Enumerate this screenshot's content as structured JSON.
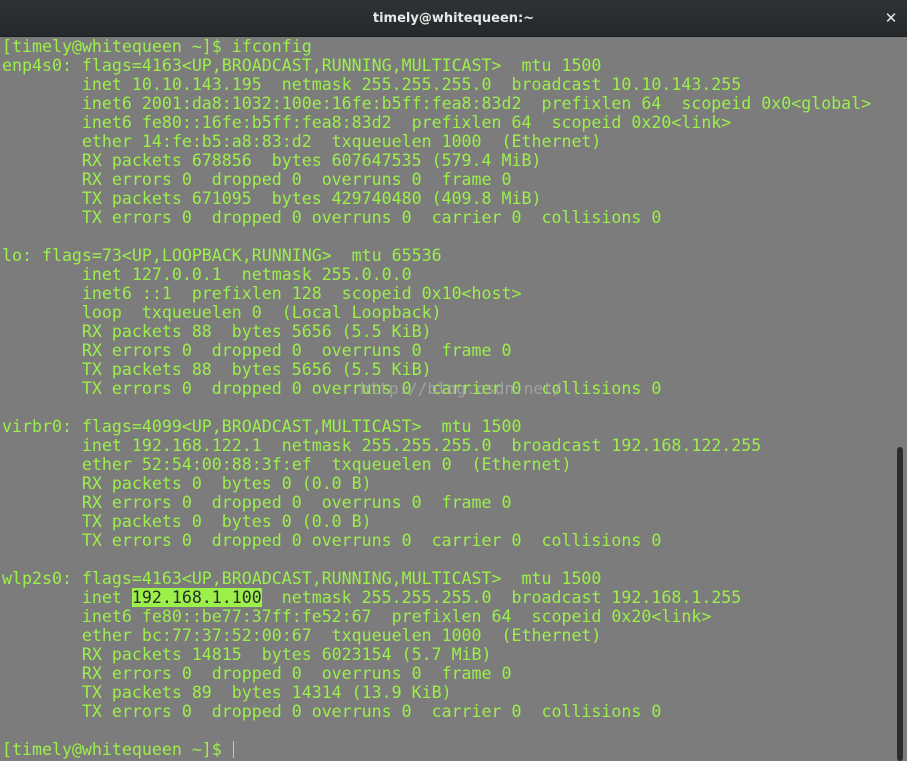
{
  "window": {
    "title": "timely@whitequeen:~",
    "close_glyph": "✕"
  },
  "terminal": {
    "lines": [
      "[timely@whitequeen ~]$ ifconfig",
      "enp4s0: flags=4163<UP,BROADCAST,RUNNING,MULTICAST>  mtu 1500",
      "        inet 10.10.143.195  netmask 255.255.255.0  broadcast 10.10.143.255",
      "        inet6 2001:da8:1032:100e:16fe:b5ff:fea8:83d2  prefixlen 64  scopeid 0x0<global>",
      "        inet6 fe80::16fe:b5ff:fea8:83d2  prefixlen 64  scopeid 0x20<link>",
      "        ether 14:fe:b5:a8:83:d2  txqueuelen 1000  (Ethernet)",
      "        RX packets 678856  bytes 607647535 (579.4 MiB)",
      "        RX errors 0  dropped 0  overruns 0  frame 0",
      "        TX packets 671095  bytes 429740480 (409.8 MiB)",
      "        TX errors 0  dropped 0 overruns 0  carrier 0  collisions 0",
      "",
      "lo: flags=73<UP,LOOPBACK,RUNNING>  mtu 65536",
      "        inet 127.0.0.1  netmask 255.0.0.0",
      "        inet6 ::1  prefixlen 128  scopeid 0x10<host>",
      "        loop  txqueuelen 0  (Local Loopback)",
      "        RX packets 88  bytes 5656 (5.5 KiB)",
      "        RX errors 0  dropped 0  overruns 0  frame 0",
      "        TX packets 88  bytes 5656 (5.5 KiB)",
      "        TX errors 0  dropped 0 overruns 0  carrier 0  collisions 0",
      "",
      "virbr0: flags=4099<UP,BROADCAST,MULTICAST>  mtu 1500",
      "        inet 192.168.122.1  netmask 255.255.255.0  broadcast 192.168.122.255",
      "        ether 52:54:00:88:3f:ef  txqueuelen 0  (Ethernet)",
      "        RX packets 0  bytes 0 (0.0 B)",
      "        RX errors 0  dropped 0  overruns 0  frame 0",
      "        TX packets 0  bytes 0 (0.0 B)",
      "        TX errors 0  dropped 0 overruns 0  carrier 0  collisions 0",
      "",
      "wlp2s0: flags=4163<UP,BROADCAST,RUNNING,MULTICAST>  mtu 1500",
      null,
      "        inet6 fe80::be77:37ff:fe52:67  prefixlen 64  scopeid 0x20<link>",
      "        ether bc:77:37:52:00:67  txqueuelen 1000  (Ethernet)",
      "        RX packets 14815  bytes 6023154 (5.7 MiB)",
      "        RX errors 0  dropped 0  overruns 0  frame 0",
      "        TX packets 89  bytes 14314 (13.9 KiB)",
      "        TX errors 0  dropped 0 overruns 0  carrier 0  collisions 0",
      "",
      "[timely@whitequeen ~]$ "
    ],
    "highlight_line": {
      "prefix": "        inet ",
      "highlight": "192.168.1.100",
      "suffix": "  netmask 255.255.255.0  broadcast 192.168.1.255"
    },
    "watermark": "http://blog.csdn.net/",
    "text_color": "#9cf04a",
    "background_color": "#7c7c7c"
  }
}
